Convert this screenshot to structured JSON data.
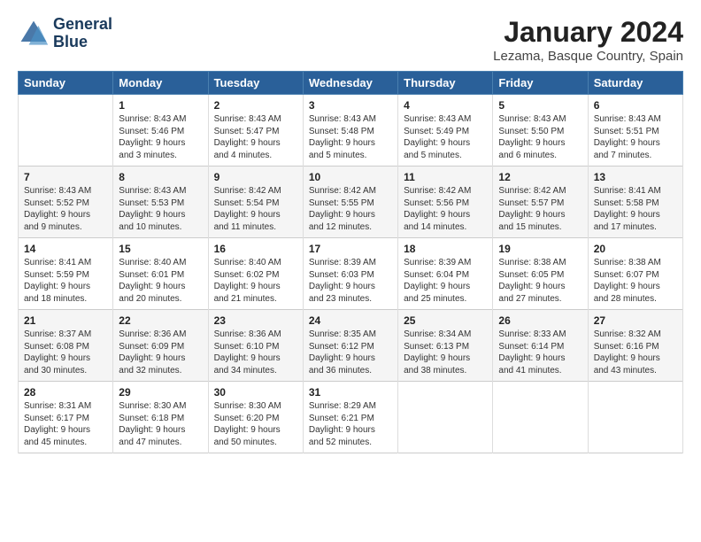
{
  "logo": {
    "line1": "General",
    "line2": "Blue"
  },
  "title": "January 2024",
  "subtitle": "Lezama, Basque Country, Spain",
  "headers": [
    "Sunday",
    "Monday",
    "Tuesday",
    "Wednesday",
    "Thursday",
    "Friday",
    "Saturday"
  ],
  "weeks": [
    [
      {
        "day": "",
        "sunrise": "",
        "sunset": "",
        "daylight": ""
      },
      {
        "day": "1",
        "sunrise": "Sunrise: 8:43 AM",
        "sunset": "Sunset: 5:46 PM",
        "daylight": "Daylight: 9 hours and 3 minutes."
      },
      {
        "day": "2",
        "sunrise": "Sunrise: 8:43 AM",
        "sunset": "Sunset: 5:47 PM",
        "daylight": "Daylight: 9 hours and 4 minutes."
      },
      {
        "day": "3",
        "sunrise": "Sunrise: 8:43 AM",
        "sunset": "Sunset: 5:48 PM",
        "daylight": "Daylight: 9 hours and 5 minutes."
      },
      {
        "day": "4",
        "sunrise": "Sunrise: 8:43 AM",
        "sunset": "Sunset: 5:49 PM",
        "daylight": "Daylight: 9 hours and 5 minutes."
      },
      {
        "day": "5",
        "sunrise": "Sunrise: 8:43 AM",
        "sunset": "Sunset: 5:50 PM",
        "daylight": "Daylight: 9 hours and 6 minutes."
      },
      {
        "day": "6",
        "sunrise": "Sunrise: 8:43 AM",
        "sunset": "Sunset: 5:51 PM",
        "daylight": "Daylight: 9 hours and 7 minutes."
      }
    ],
    [
      {
        "day": "7",
        "sunrise": "Sunrise: 8:43 AM",
        "sunset": "Sunset: 5:52 PM",
        "daylight": "Daylight: 9 hours and 9 minutes."
      },
      {
        "day": "8",
        "sunrise": "Sunrise: 8:43 AM",
        "sunset": "Sunset: 5:53 PM",
        "daylight": "Daylight: 9 hours and 10 minutes."
      },
      {
        "day": "9",
        "sunrise": "Sunrise: 8:42 AM",
        "sunset": "Sunset: 5:54 PM",
        "daylight": "Daylight: 9 hours and 11 minutes."
      },
      {
        "day": "10",
        "sunrise": "Sunrise: 8:42 AM",
        "sunset": "Sunset: 5:55 PM",
        "daylight": "Daylight: 9 hours and 12 minutes."
      },
      {
        "day": "11",
        "sunrise": "Sunrise: 8:42 AM",
        "sunset": "Sunset: 5:56 PM",
        "daylight": "Daylight: 9 hours and 14 minutes."
      },
      {
        "day": "12",
        "sunrise": "Sunrise: 8:42 AM",
        "sunset": "Sunset: 5:57 PM",
        "daylight": "Daylight: 9 hours and 15 minutes."
      },
      {
        "day": "13",
        "sunrise": "Sunrise: 8:41 AM",
        "sunset": "Sunset: 5:58 PM",
        "daylight": "Daylight: 9 hours and 17 minutes."
      }
    ],
    [
      {
        "day": "14",
        "sunrise": "Sunrise: 8:41 AM",
        "sunset": "Sunset: 5:59 PM",
        "daylight": "Daylight: 9 hours and 18 minutes."
      },
      {
        "day": "15",
        "sunrise": "Sunrise: 8:40 AM",
        "sunset": "Sunset: 6:01 PM",
        "daylight": "Daylight: 9 hours and 20 minutes."
      },
      {
        "day": "16",
        "sunrise": "Sunrise: 8:40 AM",
        "sunset": "Sunset: 6:02 PM",
        "daylight": "Daylight: 9 hours and 21 minutes."
      },
      {
        "day": "17",
        "sunrise": "Sunrise: 8:39 AM",
        "sunset": "Sunset: 6:03 PM",
        "daylight": "Daylight: 9 hours and 23 minutes."
      },
      {
        "day": "18",
        "sunrise": "Sunrise: 8:39 AM",
        "sunset": "Sunset: 6:04 PM",
        "daylight": "Daylight: 9 hours and 25 minutes."
      },
      {
        "day": "19",
        "sunrise": "Sunrise: 8:38 AM",
        "sunset": "Sunset: 6:05 PM",
        "daylight": "Daylight: 9 hours and 27 minutes."
      },
      {
        "day": "20",
        "sunrise": "Sunrise: 8:38 AM",
        "sunset": "Sunset: 6:07 PM",
        "daylight": "Daylight: 9 hours and 28 minutes."
      }
    ],
    [
      {
        "day": "21",
        "sunrise": "Sunrise: 8:37 AM",
        "sunset": "Sunset: 6:08 PM",
        "daylight": "Daylight: 9 hours and 30 minutes."
      },
      {
        "day": "22",
        "sunrise": "Sunrise: 8:36 AM",
        "sunset": "Sunset: 6:09 PM",
        "daylight": "Daylight: 9 hours and 32 minutes."
      },
      {
        "day": "23",
        "sunrise": "Sunrise: 8:36 AM",
        "sunset": "Sunset: 6:10 PM",
        "daylight": "Daylight: 9 hours and 34 minutes."
      },
      {
        "day": "24",
        "sunrise": "Sunrise: 8:35 AM",
        "sunset": "Sunset: 6:12 PM",
        "daylight": "Daylight: 9 hours and 36 minutes."
      },
      {
        "day": "25",
        "sunrise": "Sunrise: 8:34 AM",
        "sunset": "Sunset: 6:13 PM",
        "daylight": "Daylight: 9 hours and 38 minutes."
      },
      {
        "day": "26",
        "sunrise": "Sunrise: 8:33 AM",
        "sunset": "Sunset: 6:14 PM",
        "daylight": "Daylight: 9 hours and 41 minutes."
      },
      {
        "day": "27",
        "sunrise": "Sunrise: 8:32 AM",
        "sunset": "Sunset: 6:16 PM",
        "daylight": "Daylight: 9 hours and 43 minutes."
      }
    ],
    [
      {
        "day": "28",
        "sunrise": "Sunrise: 8:31 AM",
        "sunset": "Sunset: 6:17 PM",
        "daylight": "Daylight: 9 hours and 45 minutes."
      },
      {
        "day": "29",
        "sunrise": "Sunrise: 8:30 AM",
        "sunset": "Sunset: 6:18 PM",
        "daylight": "Daylight: 9 hours and 47 minutes."
      },
      {
        "day": "30",
        "sunrise": "Sunrise: 8:30 AM",
        "sunset": "Sunset: 6:20 PM",
        "daylight": "Daylight: 9 hours and 50 minutes."
      },
      {
        "day": "31",
        "sunrise": "Sunrise: 8:29 AM",
        "sunset": "Sunset: 6:21 PM",
        "daylight": "Daylight: 9 hours and 52 minutes."
      },
      {
        "day": "",
        "sunrise": "",
        "sunset": "",
        "daylight": ""
      },
      {
        "day": "",
        "sunrise": "",
        "sunset": "",
        "daylight": ""
      },
      {
        "day": "",
        "sunrise": "",
        "sunset": "",
        "daylight": ""
      }
    ]
  ]
}
